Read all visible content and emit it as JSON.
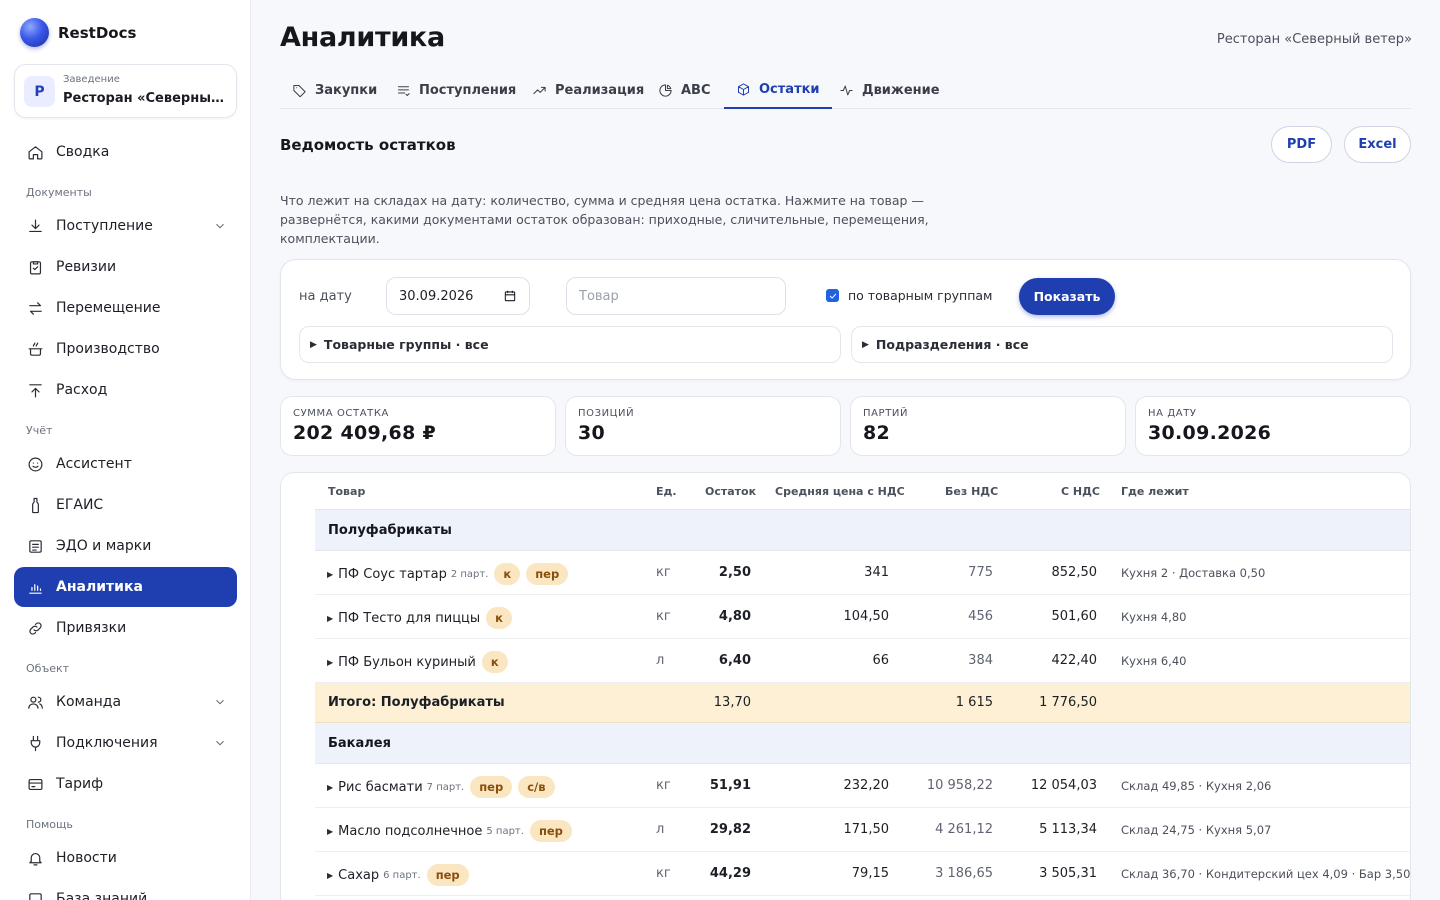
{
  "app": {
    "name": "RestDocs"
  },
  "venue": {
    "label": "Заведение",
    "avatar": "Р",
    "name": "Ресторан «Северный ветер»"
  },
  "sidebar": {
    "items": [
      {
        "label": "Сводка",
        "icon": "home-icon"
      },
      {
        "section": "Документы"
      },
      {
        "label": "Поступление",
        "icon": "download-icon",
        "expandable": true
      },
      {
        "label": "Ревизии",
        "icon": "clipboard-check-icon"
      },
      {
        "label": "Перемещение",
        "icon": "transfer-icon"
      },
      {
        "label": "Производство",
        "icon": "pot-icon"
      },
      {
        "label": "Расход",
        "icon": "upload-icon"
      },
      {
        "section": "Учёт"
      },
      {
        "label": "Ассистент",
        "icon": "assistant-icon"
      },
      {
        "label": "ЕГАИС",
        "icon": "bottle-icon"
      },
      {
        "label": "ЭДО и марки",
        "icon": "document-icon"
      },
      {
        "label": "Аналитика",
        "icon": "bar-chart-icon",
        "active": true
      },
      {
        "label": "Привязки",
        "icon": "link-icon"
      },
      {
        "section": "Объект"
      },
      {
        "label": "Команда",
        "icon": "users-icon",
        "expandable": true
      },
      {
        "label": "Подключения",
        "icon": "plug-icon",
        "expandable": true
      },
      {
        "label": "Тариф",
        "icon": "card-icon"
      },
      {
        "section": "Помощь"
      },
      {
        "label": "Новости",
        "icon": "bell-icon"
      },
      {
        "label": "База знаний",
        "icon": "book-icon"
      }
    ]
  },
  "header": {
    "title": "Аналитика",
    "venue": "Ресторан «Северный ветер»"
  },
  "tabs": [
    {
      "label": "Закупки",
      "icon": "tag-icon"
    },
    {
      "label": "Поступления",
      "icon": "list-icon"
    },
    {
      "label": "Реализация",
      "icon": "trend-up-icon"
    },
    {
      "label": "ABC",
      "icon": "pie-icon"
    },
    {
      "label": "Остатки",
      "icon": "box-icon",
      "active": true
    },
    {
      "label": "Движение",
      "icon": "pulse-icon"
    }
  ],
  "report": {
    "title": "Ведомость остатков",
    "pdf": "PDF",
    "excel": "Excel",
    "description": "Что лежит на складах на дату: количество, сумма и средняя цена остатка. Нажмите на товар — развернётся, какими документами остаток образован: приходные, сличительные, перемещения, комплектации."
  },
  "filters": {
    "date_label": "на дату",
    "date_value": "30.09.2026",
    "search_placeholder": "Товар",
    "group_checkbox_label": "по товарным группам",
    "group_checkbox_checked": true,
    "show_button": "Показать",
    "product_groups": "Товарные группы · все",
    "divisions": "Подразделения · все"
  },
  "stats": [
    {
      "label": "Сумма остатка",
      "value": "202 409,68 ₽"
    },
    {
      "label": "Позиций",
      "value": "30"
    },
    {
      "label": "Партий",
      "value": "82"
    },
    {
      "label": "На дату",
      "value": "30.09.2026"
    }
  ],
  "table": {
    "columns": [
      "Товар",
      "Ед.",
      "Остаток",
      "Средняя цена с НДС",
      "Без НДС",
      "С НДС",
      "Где лежит"
    ],
    "groups": [
      {
        "name": "Полуфабрикаты",
        "rows": [
          {
            "name": "ПФ Соус тартар",
            "parts": "2 парт.",
            "chips": [
              "к",
              "пер"
            ],
            "unit": "кг",
            "qty": "2,50",
            "avg": "341",
            "no_vat": "775",
            "vat": "852,50",
            "where": "Кухня 2 · Доставка 0,50"
          },
          {
            "name": "ПФ Тесто для пиццы",
            "parts": "",
            "chips": [
              "к"
            ],
            "unit": "кг",
            "qty": "4,80",
            "avg": "104,50",
            "no_vat": "456",
            "vat": "501,60",
            "where": "Кухня 4,80"
          },
          {
            "name": "ПФ Бульон куриный",
            "parts": "",
            "chips": [
              "к"
            ],
            "unit": "л",
            "qty": "6,40",
            "avg": "66",
            "no_vat": "384",
            "vat": "422,40",
            "where": "Кухня 6,40"
          }
        ],
        "total": {
          "label": "Итого: Полуфабрикаты",
          "qty": "13,70",
          "no_vat": "1 615",
          "vat": "1 776,50"
        }
      },
      {
        "name": "Бакалея",
        "rows": [
          {
            "name": "Рис басмати",
            "parts": "7 парт.",
            "chips": [
              "пер",
              "с/в"
            ],
            "unit": "кг",
            "qty": "51,91",
            "avg": "232,20",
            "no_vat": "10 958,22",
            "vat": "12 054,03",
            "where": "Склад 49,85 · Кухня 2,06"
          },
          {
            "name": "Масло подсолнечное",
            "parts": "5 парт.",
            "chips": [
              "пер"
            ],
            "unit": "л",
            "qty": "29,82",
            "avg": "171,50",
            "no_vat": "4 261,12",
            "vat": "5 113,34",
            "where": "Склад 24,75 · Кухня 5,07"
          },
          {
            "name": "Сахар",
            "parts": "6 парт.",
            "chips": [
              "пер"
            ],
            "unit": "кг",
            "qty": "44,29",
            "avg": "79,15",
            "no_vat": "3 186,65",
            "vat": "3 505,31",
            "where": "Склад 36,70 · Кондитерский цех 4,09 · Бар 3,50"
          }
        ]
      }
    ]
  },
  "colors": {
    "accent": "#1f3fb0",
    "group_bg": "#eef2fb",
    "total_bg": "#fdf0d4",
    "chip_bg": "#fbe6c2"
  }
}
